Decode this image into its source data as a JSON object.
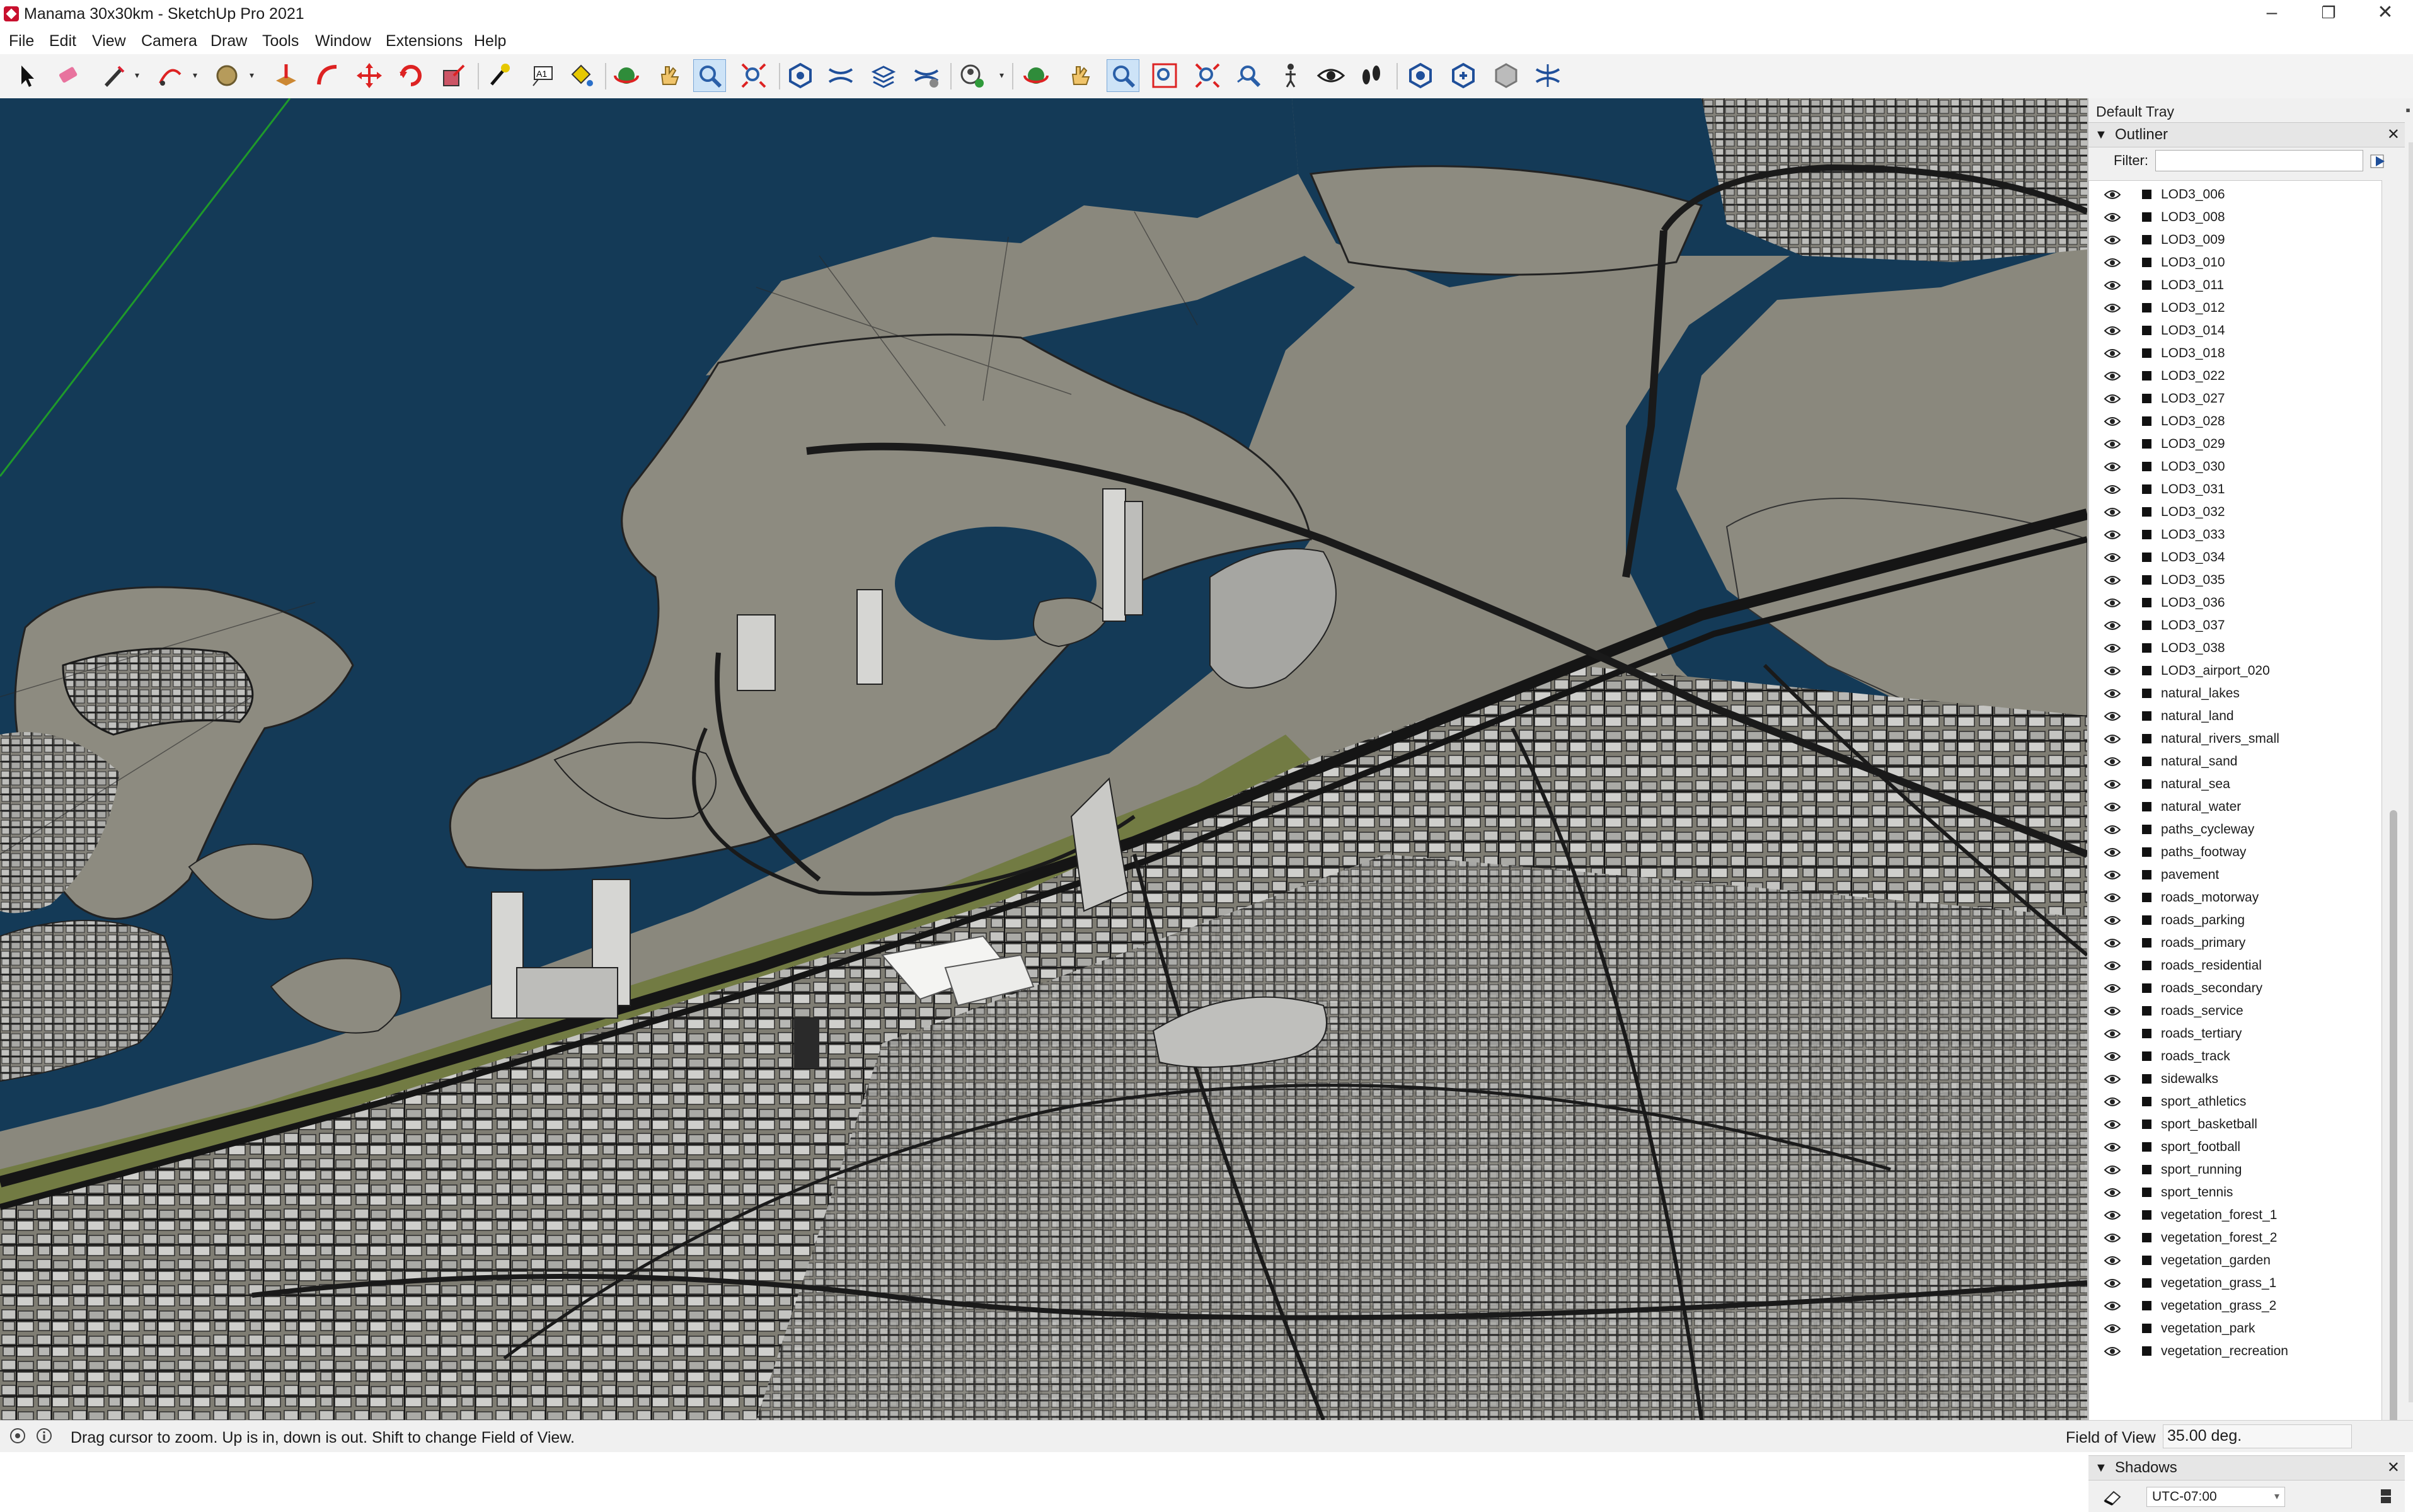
{
  "window": {
    "title": "Manama 30x30km - SketchUp Pro 2021",
    "minimize": "–",
    "maximize": "❐",
    "close": "✕"
  },
  "menu": [
    "File",
    "Edit",
    "View",
    "Camera",
    "Draw",
    "Tools",
    "Window",
    "Extensions",
    "Help"
  ],
  "toolbar_icons": [
    "select-icon",
    "eraser-icon",
    "pencil-icon",
    "arc-icon",
    "circle-icon",
    "pushpull-icon",
    "followme-icon",
    "move-icon",
    "rotate-icon",
    "scale-icon",
    "tape-measure-icon",
    "text-icon",
    "paint-bucket-icon",
    "orbit-icon",
    "pan-icon",
    "zoom-icon",
    "zoom-extents-icon",
    "sandbox-icon-1",
    "sandbox-icon-2",
    "sandbox-icon-3",
    "sandbox-icon-4",
    "geolocation-icon",
    "orbit-icon-2",
    "pan-icon-2",
    "zoom-icon-2",
    "zoom-window-icon",
    "zoom-extents-icon-2",
    "previous-view-icon",
    "position-camera-icon",
    "look-around-icon",
    "walk-icon",
    "ext-icon-1",
    "ext-icon-2",
    "ext-icon-3",
    "ext-icon-4"
  ],
  "tray": {
    "title": "Default Tray",
    "outliner": {
      "title": "Outliner",
      "filter_label": "Filter:",
      "filter_value": "",
      "items": [
        "LOD3_006",
        "LOD3_008",
        "LOD3_009",
        "LOD3_010",
        "LOD3_011",
        "LOD3_012",
        "LOD3_014",
        "LOD3_018",
        "LOD3_022",
        "LOD3_027",
        "LOD3_028",
        "LOD3_029",
        "LOD3_030",
        "LOD3_031",
        "LOD3_032",
        "LOD3_033",
        "LOD3_034",
        "LOD3_035",
        "LOD3_036",
        "LOD3_037",
        "LOD3_038",
        "LOD3_airport_020",
        "natural_lakes",
        "natural_land",
        "natural_rivers_small",
        "natural_sand",
        "natural_sea",
        "natural_water",
        "paths_cycleway",
        "paths_footway",
        "pavement",
        "roads_motorway",
        "roads_parking",
        "roads_primary",
        "roads_residential",
        "roads_secondary",
        "roads_service",
        "roads_tertiary",
        "roads_track",
        "sidewalks",
        "sport_athletics",
        "sport_basketball",
        "sport_football",
        "sport_running",
        "sport_tennis",
        "vegetation_forest_1",
        "vegetation_forest_2",
        "vegetation_garden",
        "vegetation_grass_1",
        "vegetation_grass_2",
        "vegetation_park",
        "vegetation_recreation"
      ]
    },
    "shadows": {
      "title": "Shadows",
      "timezone": "UTC-07:00"
    }
  },
  "status": {
    "message": "Drag cursor to zoom.  Up is in, down is out. Shift to change Field of View.",
    "fov_label": "Field of View",
    "fov_value": "35.00 deg."
  },
  "colors": {
    "water": "#143a57",
    "land": "#8a887d",
    "roads": "#1a1a1a",
    "buildings": "#b9b9b6",
    "vegetation": "#6f7a3d"
  }
}
